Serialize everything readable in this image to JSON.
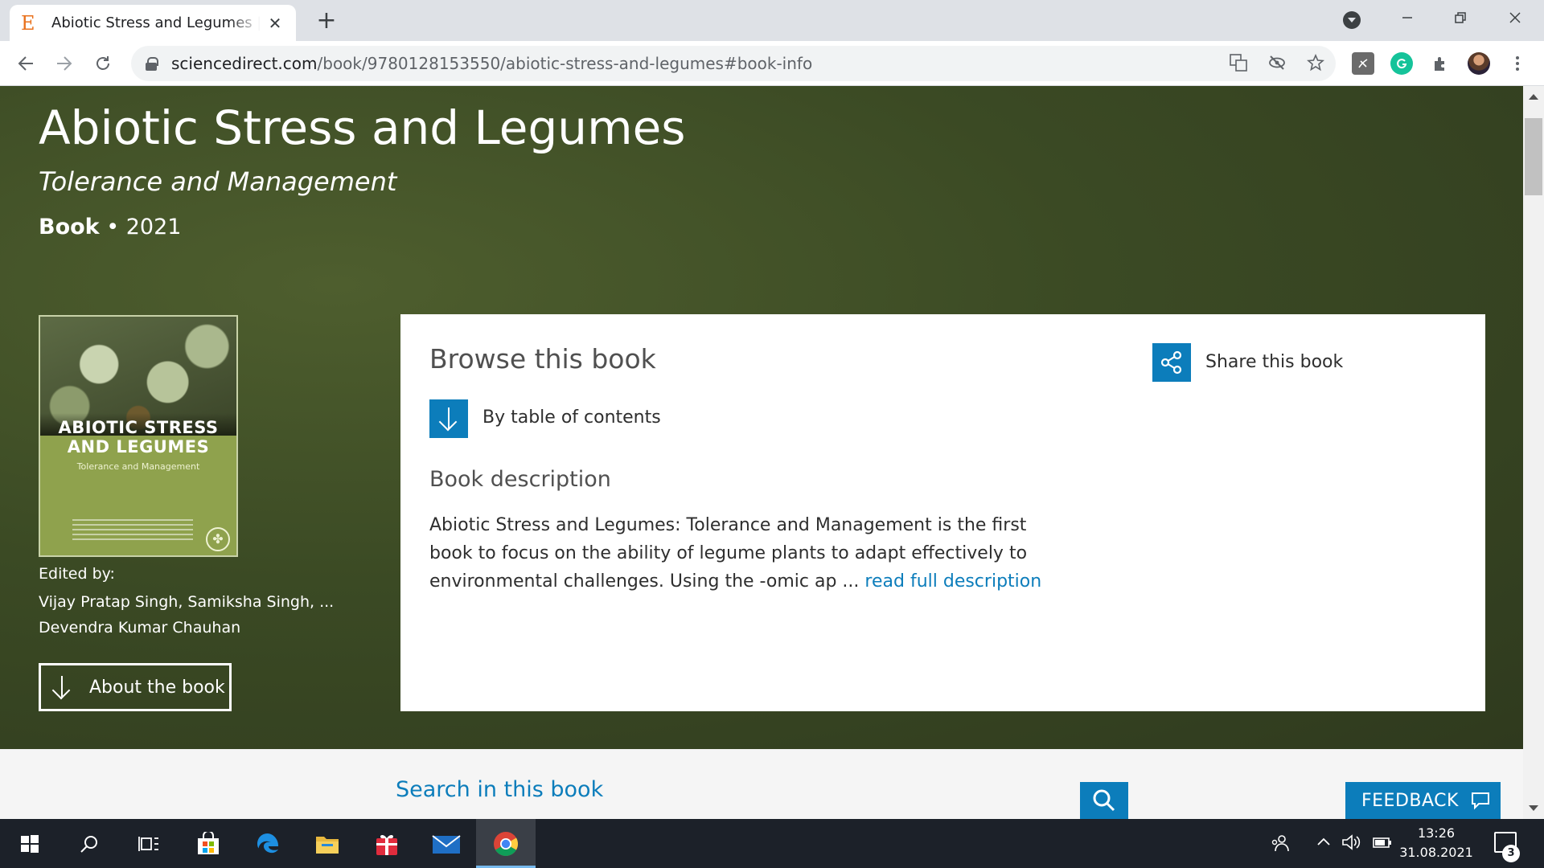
{
  "browser": {
    "tab_title": "Abiotic Stress and Legumes | ScienceDirect",
    "tab_favicon": "E",
    "close_glyph": "✕",
    "newtab_glyph": "+",
    "url_host": "sciencedirect.com",
    "url_path": "/book/9780128153550/abiotic-stress-and-legumes#book-info"
  },
  "hero": {
    "title": "Abiotic Stress and Legumes",
    "subtitle": "Tolerance and Management",
    "type": "Book",
    "separator": " • ",
    "year": "2021"
  },
  "cover": {
    "line1": "ABIOTIC STRESS",
    "line2": "AND LEGUMES",
    "subtitle": "Tolerance and Management"
  },
  "editors": {
    "label": "Edited by:",
    "names": "Vijay Pratap Singh, Samiksha Singh, ... Devendra Kumar Chauhan"
  },
  "about_button": "About the book",
  "panel": {
    "browse_title": "Browse this book",
    "toc_label": "By table of contents",
    "desc_title": "Book description",
    "desc_text": "Abiotic Stress and Legumes: Tolerance and Management is the first book to focus on the ability of legume plants to adapt effectively to environmental challenges. Using the -omic ap ... ",
    "desc_link": "read full description",
    "share_label": "Share this book"
  },
  "search": {
    "label": "Search in this book"
  },
  "feedback": "FEEDBACK",
  "taskbar": {
    "time": "13:26",
    "date": "31.08.2021",
    "notifications": "3"
  },
  "colors": {
    "accent": "#0c7dbb",
    "hero_bg": "#3b4a24",
    "taskbar": "#1c2129"
  }
}
